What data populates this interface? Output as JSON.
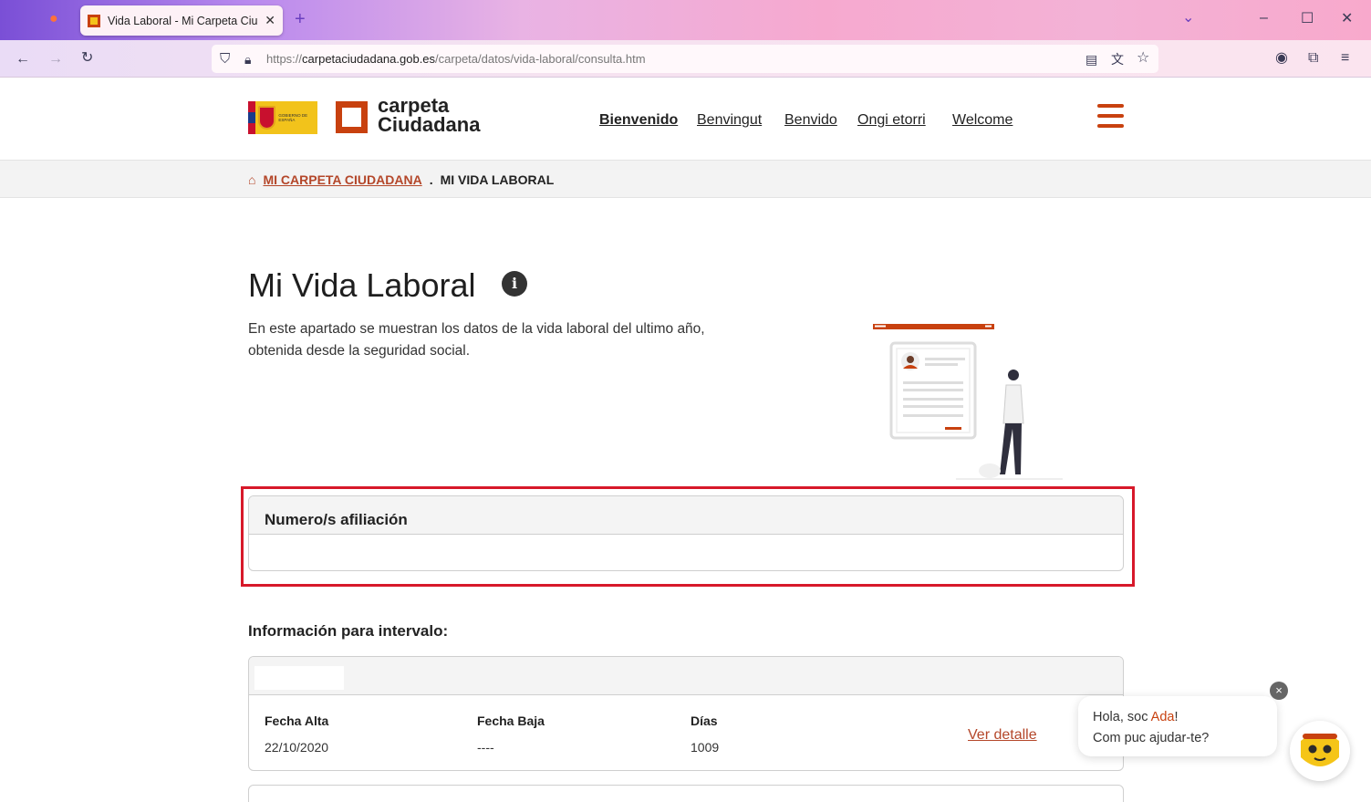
{
  "browser": {
    "tab_title": "Vida Laboral - Mi Carpeta Ciuda",
    "url_prefix": "https://",
    "url_host": "carpetaciudadana.gob.es",
    "url_path": "/carpeta/datos/vida-laboral/consulta.htm"
  },
  "header": {
    "gov_logo_text": "GOBIERNO DE ESPAÑA",
    "logo_line1": "carpeta",
    "logo_line2": "Ciudadana",
    "languages": [
      "Bienvenido",
      "Benvingut",
      "Benvido",
      "Ongi etorri",
      "Welcome"
    ]
  },
  "breadcrumb": {
    "home": "MI CARPETA CIUDADANA",
    "separator": ".",
    "current": "MI VIDA LABORAL"
  },
  "main": {
    "title": "Mi Vida Laboral",
    "info_symbol": "i",
    "intro": "En este apartado se muestran los datos de la vida laboral del ultimo año, obtenida desde la seguridad social.",
    "afiliacion_title": "Numero/s afiliación",
    "interval_title": "Información para intervalo:",
    "interval": {
      "fecha_alta_label": "Fecha Alta",
      "fecha_alta_value": "22/10/2020",
      "fecha_baja_label": "Fecha Baja",
      "fecha_baja_value": "----",
      "dias_label": "Días",
      "dias_value": "1009",
      "detail_link": "Ver detalle"
    }
  },
  "chat": {
    "greeting_prefix": "Hola, soc ",
    "bot_name": "Ada",
    "greeting_suffix": "!",
    "question": "Com puc ajudar-te?",
    "close_symbol": "×"
  },
  "colors": {
    "brand": "#c8410f",
    "link": "#b4472a",
    "highlight": "#d7192a"
  }
}
